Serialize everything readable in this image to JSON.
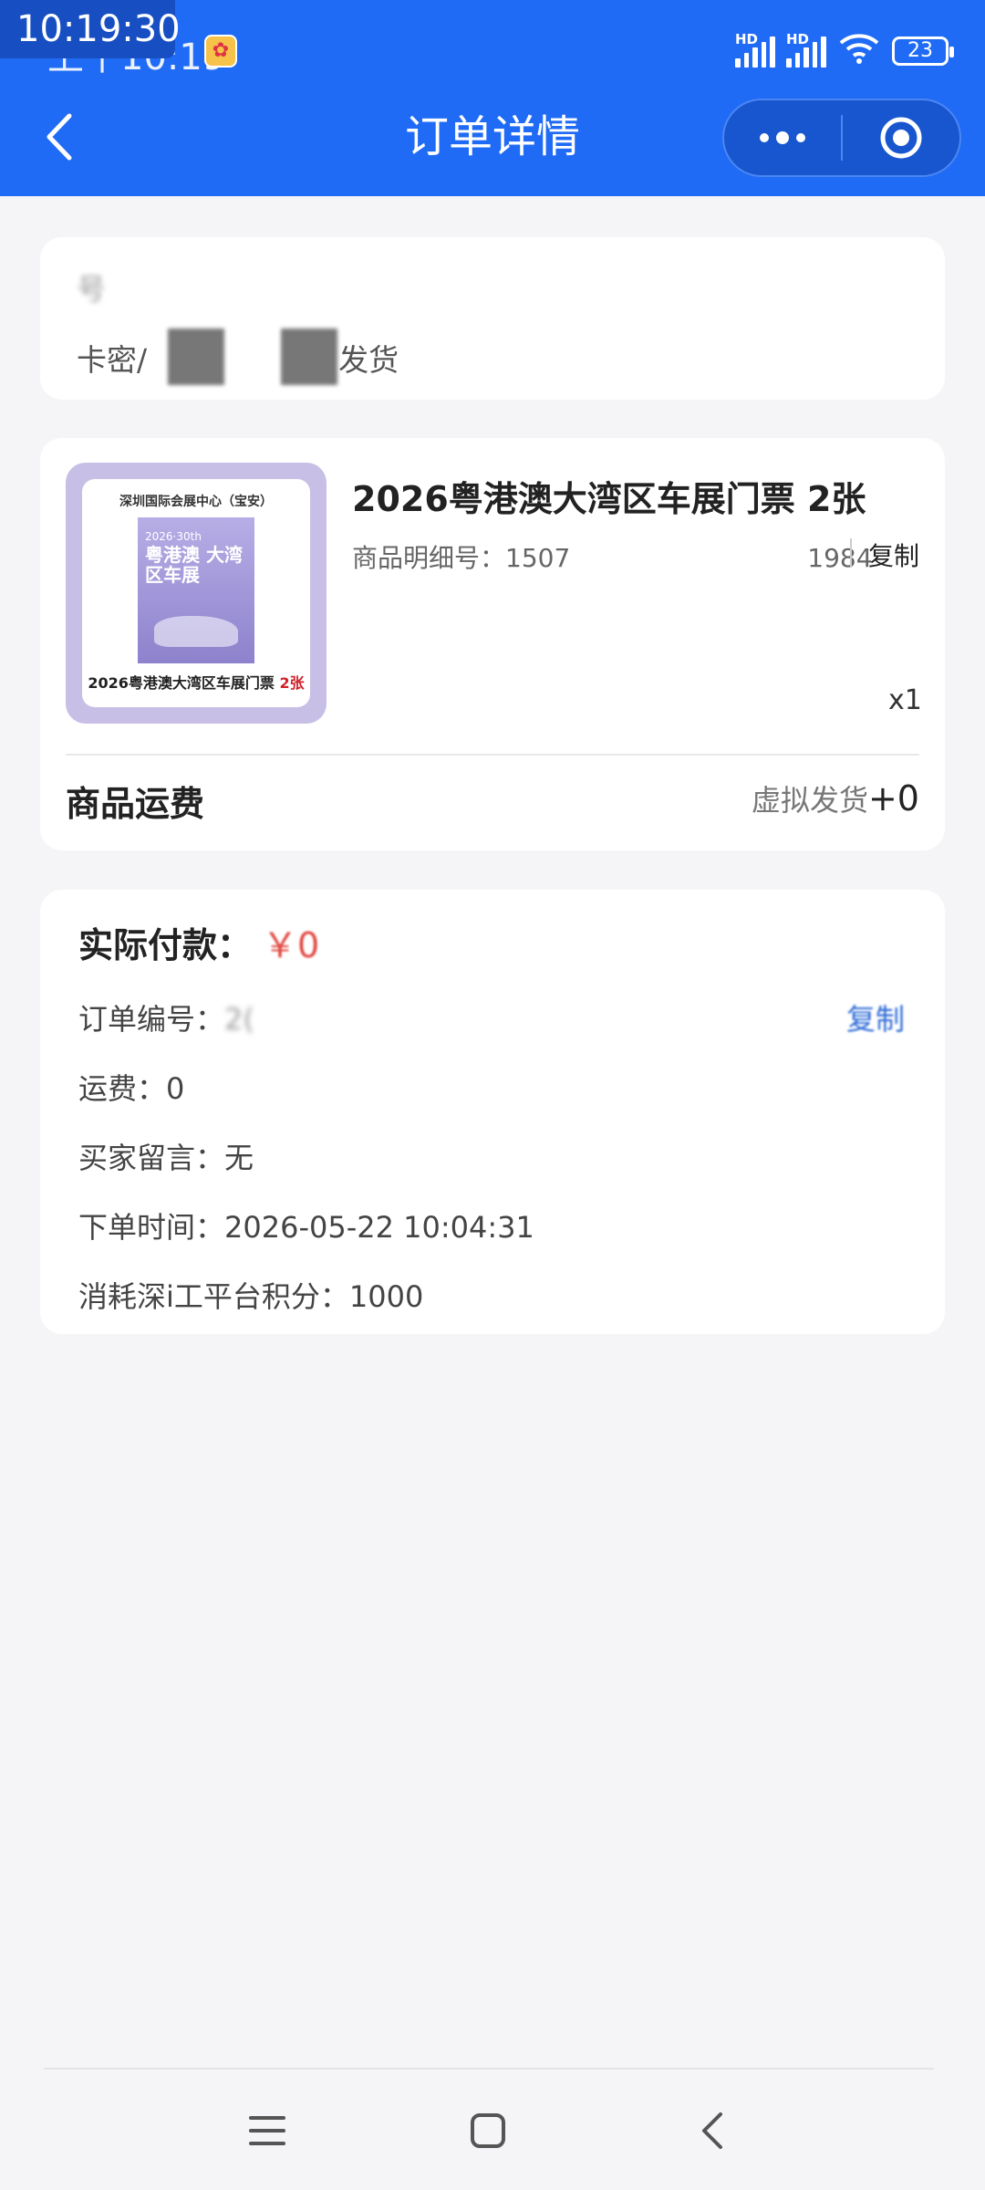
{
  "status": {
    "overlay_time": "10:19:30",
    "time": "上午10:19",
    "battery": "23",
    "signal1": "HD",
    "signal2": "HD"
  },
  "header": {
    "title": "订单详情"
  },
  "delivery": {
    "line1": "号",
    "card_label": "卡密/",
    "card_suffix": "发货"
  },
  "product": {
    "image": {
      "venue": "深圳国际会展中心（宝安）",
      "poster_top": "2026·30th",
      "poster_title": "粤港澳 大湾区车展",
      "caption": "2026粤港澳大湾区车展门票",
      "caption_highlight": "2张"
    },
    "title": "2026粤港澳大湾区车展门票 2张",
    "sku_label": "商品明细号：",
    "sku_start": "1507",
    "sku_end": "1984",
    "copy": "复制",
    "quantity": "x1"
  },
  "shipping": {
    "label": "商品运费",
    "method": "虚拟发货",
    "amount": "+0"
  },
  "payment": {
    "label": "实际付款：",
    "amount": "￥0",
    "order_label": "订单编号：",
    "order_prefix": "2(",
    "copy": "复制",
    "fee_text": "运费：0",
    "message_text": "买家留言：无",
    "time_text": "下单时间：2026-05-22 10:04:31",
    "points_text": "消耗深i工平台积分：1000"
  },
  "colors": {
    "primary": "#1f6bf5",
    "price": "#e0453f",
    "link": "#2f6bd8",
    "background": "#f5f5f7"
  },
  "icons": {
    "back": "chevron-left-icon",
    "more": "more-dots-icon",
    "target": "target-icon",
    "menu": "menu-icon",
    "home": "home-square-icon",
    "nav_back": "chevron-left-icon"
  }
}
